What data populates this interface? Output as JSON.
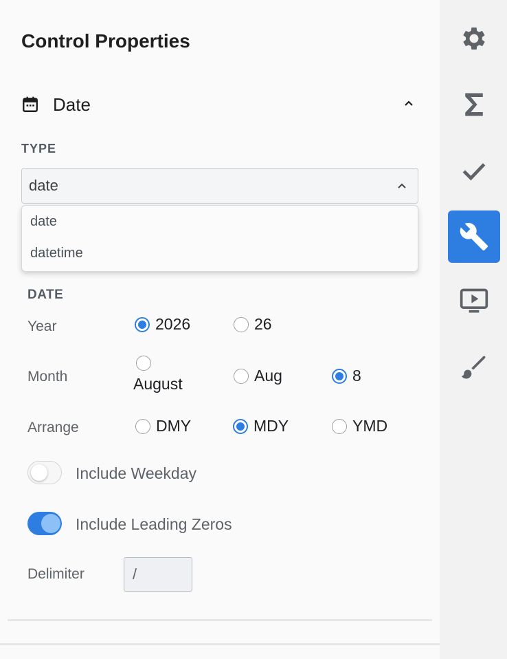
{
  "panel": {
    "title": "Control Properties"
  },
  "section": {
    "label": "Date",
    "icon": "calendar-icon"
  },
  "type": {
    "label": "TYPE",
    "selected": "date",
    "options": [
      "date",
      "datetime"
    ]
  },
  "date_group": {
    "label": "DATE",
    "year": {
      "label": "Year",
      "options": [
        {
          "label": "2026",
          "selected": true
        },
        {
          "label": "26",
          "selected": false
        }
      ]
    },
    "month": {
      "label": "Month",
      "options": [
        {
          "label": "August",
          "selected": false
        },
        {
          "label": "Aug",
          "selected": false
        },
        {
          "label": "8",
          "selected": true
        }
      ]
    },
    "arrange": {
      "label": "Arrange",
      "options": [
        {
          "label": "DMY",
          "selected": false
        },
        {
          "label": "MDY",
          "selected": true
        },
        {
          "label": "YMD",
          "selected": false
        }
      ]
    },
    "include_weekday": {
      "label": "Include Weekday",
      "on": false
    },
    "include_leading_zeros": {
      "label": "Include Leading Zeros",
      "on": true
    },
    "delimiter": {
      "label": "Delimiter",
      "value": "/"
    }
  },
  "rail": {
    "items": [
      {
        "icon": "gear-icon",
        "active": false
      },
      {
        "icon": "sigma-icon",
        "active": false
      },
      {
        "icon": "checkmark-icon",
        "active": false
      },
      {
        "icon": "wrench-icon",
        "active": true
      },
      {
        "icon": "preview-icon",
        "active": false
      },
      {
        "icon": "brush-icon",
        "active": false
      }
    ]
  },
  "colors": {
    "accent": "#2d7ee0",
    "panel_bg": "#fafafa",
    "rail_bg": "#f2f2f2"
  }
}
